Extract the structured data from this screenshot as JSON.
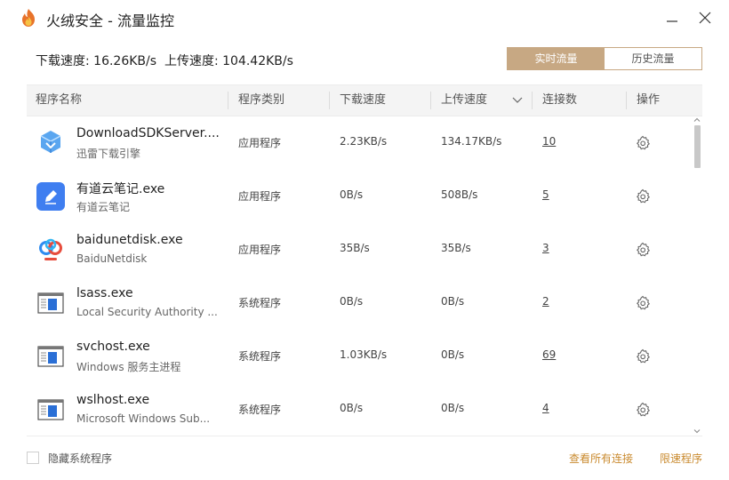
{
  "window": {
    "title": "火绒安全 - 流量监控"
  },
  "speed": {
    "download_label": "下载速度:",
    "download_value": "16.26KB/s",
    "upload_label": "上传速度:",
    "upload_value": "104.42KB/s"
  },
  "tabs": {
    "realtime": "实时流量",
    "history": "历史流量",
    "active": "realtime"
  },
  "columns": {
    "name": "程序名称",
    "type": "程序类别",
    "download": "下载速度",
    "upload": "上传速度",
    "connections": "连接数",
    "action": "操作"
  },
  "rows": [
    {
      "name": "DownloadSDKServer....",
      "desc": "迅雷下载引擎",
      "type": "应用程序",
      "download": "2.23KB/s",
      "upload": "134.17KB/s",
      "connections": "10",
      "icon": "thunder-download-icon"
    },
    {
      "name": "有道云笔记.exe",
      "desc": "有道云笔记",
      "type": "应用程序",
      "download": "0B/s",
      "upload": "508B/s",
      "connections": "5",
      "icon": "youdao-note-icon"
    },
    {
      "name": "baidunetdisk.exe",
      "desc": "BaiduNetdisk",
      "type": "应用程序",
      "download": "35B/s",
      "upload": "35B/s",
      "connections": "3",
      "icon": "baidu-netdisk-icon"
    },
    {
      "name": "lsass.exe",
      "desc": "Local Security Authority ...",
      "type": "系统程序",
      "download": "0B/s",
      "upload": "0B/s",
      "connections": "2",
      "icon": "system-program-icon"
    },
    {
      "name": "svchost.exe",
      "desc": "Windows 服务主进程",
      "type": "系统程序",
      "download": "1.03KB/s",
      "upload": "0B/s",
      "connections": "69",
      "icon": "system-program-icon"
    },
    {
      "name": "wslhost.exe",
      "desc": "Microsoft Windows Sub...",
      "type": "系统程序",
      "download": "0B/s",
      "upload": "0B/s",
      "connections": "4",
      "icon": "system-program-icon"
    }
  ],
  "footer": {
    "hide_system_label": "隐藏系统程序",
    "hide_system_checked": false,
    "view_all_link": "查看所有连接",
    "limit_speed_link": "限速程序"
  },
  "colors": {
    "accent": "#c7a883",
    "link": "#c98a2e",
    "header_bg": "#f4f4f4"
  }
}
